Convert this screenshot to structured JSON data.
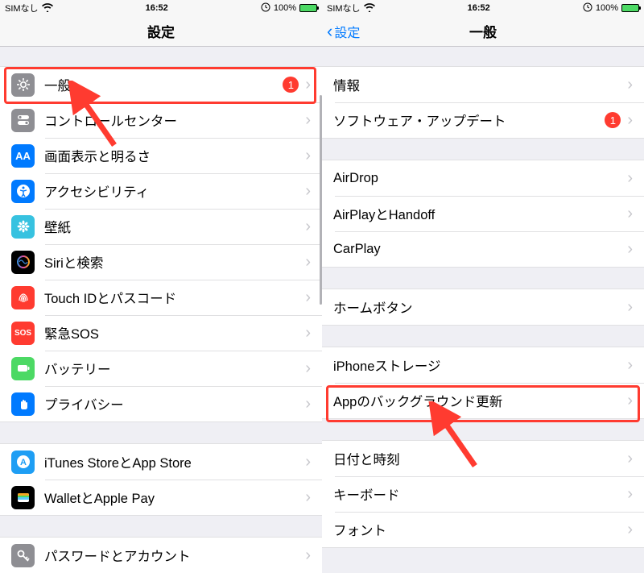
{
  "status": {
    "carrier": "SIMなし",
    "time": "16:52",
    "battery_pct": "100%"
  },
  "left": {
    "title": "設定",
    "groups": [
      {
        "items": [
          {
            "icon": "gear",
            "bg": "#8e8e93",
            "label": "一般",
            "badge": "1"
          },
          {
            "icon": "toggles",
            "bg": "#8e8e93",
            "label": "コントロールセンター"
          },
          {
            "icon": "AA",
            "bg": "#007aff",
            "label": "画面表示と明るさ"
          },
          {
            "icon": "access",
            "bg": "#007aff",
            "label": "アクセシビリティ"
          },
          {
            "icon": "flower",
            "bg": "#37c2e0",
            "label": "壁紙"
          },
          {
            "icon": "siri",
            "bg": "#000",
            "label": "Siriと検索"
          },
          {
            "icon": "touchid",
            "bg": "#ff3b30",
            "label": "Touch IDとパスコード"
          },
          {
            "icon": "SOS",
            "bg": "#ff3b30",
            "label": "緊急SOS"
          },
          {
            "icon": "battery",
            "bg": "#4cd964",
            "label": "バッテリー"
          },
          {
            "icon": "hand",
            "bg": "#007aff",
            "label": "プライバシー"
          }
        ]
      },
      {
        "items": [
          {
            "icon": "A",
            "bg": "#1e9ef4",
            "label": "iTunes StoreとApp Store"
          },
          {
            "icon": "wallet",
            "bg": "#000",
            "label": "WalletとApple Pay"
          }
        ]
      },
      {
        "items": [
          {
            "icon": "key",
            "bg": "#8e8e93",
            "label": "パスワードとアカウント"
          }
        ]
      }
    ]
  },
  "right": {
    "back": "設定",
    "title": "一般",
    "groups": [
      {
        "items": [
          {
            "label": "情報"
          },
          {
            "label": "ソフトウェア・アップデート",
            "badge": "1"
          }
        ]
      },
      {
        "items": [
          {
            "label": "AirDrop"
          },
          {
            "label": "AirPlayとHandoff"
          },
          {
            "label": "CarPlay"
          }
        ]
      },
      {
        "items": [
          {
            "label": "ホームボタン"
          }
        ]
      },
      {
        "items": [
          {
            "label": "iPhoneストレージ"
          },
          {
            "label": "Appのバックグラウンド更新"
          }
        ]
      },
      {
        "items": [
          {
            "label": "日付と時刻"
          },
          {
            "label": "キーボード"
          },
          {
            "label": "フォント"
          }
        ]
      }
    ]
  },
  "icon_bg": {
    "gear": "#8e8e93",
    "toggles": "#8e8e93",
    "AA": "#007aff",
    "access": "#007aff",
    "flower": "#37c2e0",
    "siri": "#1b1b2a",
    "touchid": "#ff3b30",
    "SOS": "#ff3b30",
    "battery": "#4cd964",
    "hand": "#007aff",
    "A": "#1e9ef4",
    "wallet": "#000",
    "key": "#8e8e93"
  }
}
